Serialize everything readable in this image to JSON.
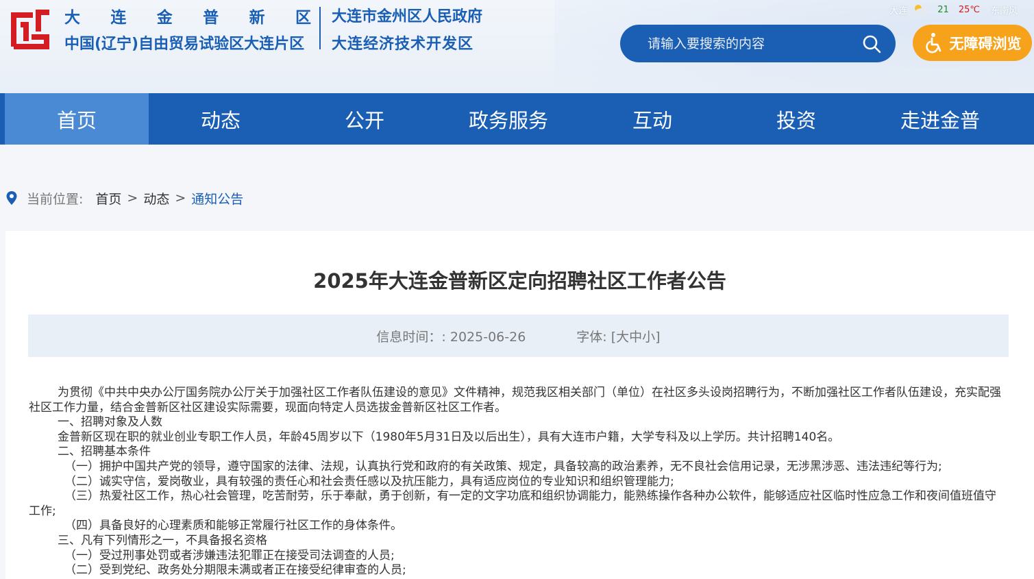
{
  "header": {
    "brand_chars": [
      "大",
      "连",
      "金",
      "普",
      "新",
      "区"
    ],
    "brand_sub": "中国(辽宁)自由贸易试验区大连片区",
    "gov1": "大连市金州区人民政府",
    "gov2": "大连经济技术开发区",
    "weather": {
      "city": "大连",
      "low": "21",
      "high": "25℃",
      "wind": "东南风 ",
      "icon": "partly-cloudy-icon"
    },
    "search_placeholder": "请输入要搜索的内容",
    "accessibility_label": "无障碍浏览",
    "colors": {
      "primary": "#1a5fb4",
      "accent": "#f7a21b",
      "logo_red": "#d41c23"
    }
  },
  "nav": {
    "items": [
      "首页",
      "动态",
      "公开",
      "政务服务",
      "互动",
      "投资",
      "走进金普"
    ],
    "active_index": 0
  },
  "breadcrumb": {
    "label": "当前位置:",
    "items": [
      "首页",
      "动态",
      "通知公告"
    ],
    "sep": ">"
  },
  "article": {
    "title": "2025年大连金普新区定向招聘社区工作者公告",
    "date": "信息时间：: 2025-06-26",
    "font": "字体: [大中小]",
    "paragraphs": [
      "为贯彻《中共中央办公厅国务院办公厅关于加强社区工作者队伍建设的意见》文件精神，规范我区相关部门（单位）在社区多头设岗招聘行为，不断加强社区工作者队伍建设，充实配强社区工作力量，结合金普新区社区建设实际需要，现面向特定人员选拔金普新区社区工作者。",
      "一、招聘对象及人数",
      "金普新区现在职的就业创业专职工作人员，年龄45周岁以下（1980年5月31日及以后出生），具有大连市户籍，大学专科及以上学历。共计招聘140名。",
      "二、招聘基本条件",
      "（一）拥护中国共产党的领导，遵守国家的法律、法规，认真执行党和政府的有关政策、规定，具备较高的政治素养，无不良社会信用记录，无涉黑涉恶、违法违纪等行为;",
      "（二）诚实守信，爱岗敬业，具有较强的责任心和社会责任感以及抗压能力，具有适应岗位的专业知识和组织管理能力;",
      "（三）热爱社区工作，热心社会管理，吃苦耐劳，乐于奉献，勇于创新，有一定的文字功底和组织协调能力，能熟练操作各种办公软件，能够适应社区临时性应急工作和夜间值班值守工作;",
      "（四）具备良好的心理素质和能够正常履行社区工作的身体条件。",
      "三、凡有下列情形之一，不具备报名资格",
      "（一）受过刑事处罚或者涉嫌违法犯罪正在接受司法调查的人员;",
      "（二）受到党纪、政务处分期限未满或者正在接受纪律审查的人员;"
    ]
  }
}
